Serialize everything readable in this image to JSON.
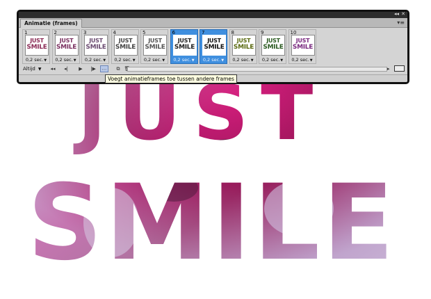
{
  "panel": {
    "tab_label": "Animatie (frames)",
    "loop_label": "Altijd",
    "tooltip": "Voegt animatieframes toe tussen andere frames",
    "collapse_icon": "double-chevron-icon",
    "close_icon": "close-icon",
    "menu_icon": "panel-menu-icon"
  },
  "frames": [
    {
      "number": "1",
      "delay": "0,2 sec.",
      "selected": false
    },
    {
      "number": "2",
      "delay": "0,2 sec.",
      "selected": false
    },
    {
      "number": "3",
      "delay": "0,2 sec.",
      "selected": false
    },
    {
      "number": "4",
      "delay": "0,2 sec.",
      "selected": false
    },
    {
      "number": "5",
      "delay": "0,2 sec.",
      "selected": false
    },
    {
      "number": "6",
      "delay": "0,2 sec.",
      "selected": true
    },
    {
      "number": "7",
      "delay": "0,2 sec.",
      "selected": true
    },
    {
      "number": "8",
      "delay": "0,2 sec.",
      "selected": false
    },
    {
      "number": "9",
      "delay": "0,2 sec.",
      "selected": false
    },
    {
      "number": "10",
      "delay": "0,2 sec.",
      "selected": false
    }
  ],
  "thumbnail_text": {
    "line1": "JUST",
    "line2": "SMILE"
  },
  "artwork": {
    "line1": "JUST",
    "line2": "SMILE"
  },
  "thumb_colors": [
    "#8a2a55",
    "#7a3060",
    "#6a4a70",
    "#444444",
    "#555555",
    "#222222",
    "#111111",
    "#5a6a10",
    "#2a5a20",
    "#7a2a80"
  ],
  "colors": {
    "selection": "#3f8fdf",
    "panel": "#d4d4d4",
    "magenta": "#c0187a"
  },
  "toolbar_icons": [
    "first-frame-icon",
    "previous-frame-icon",
    "play-icon",
    "next-frame-icon",
    "tween-icon",
    "duplicate-frame-icon",
    "delete-frame-icon"
  ]
}
